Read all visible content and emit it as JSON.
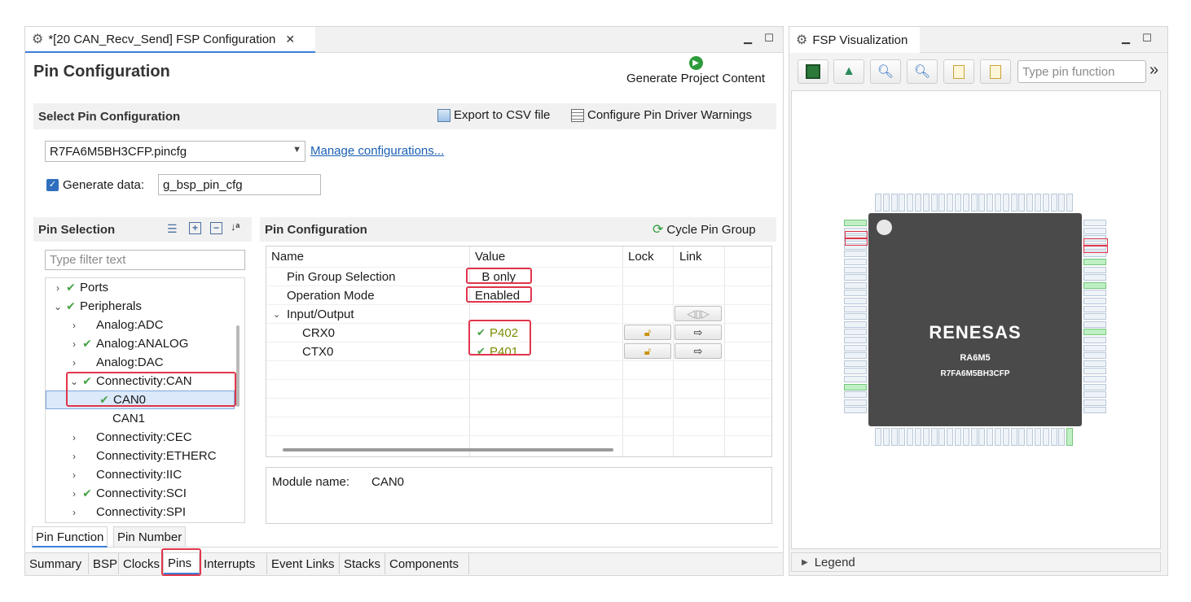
{
  "editor": {
    "tab_title": "*[20 CAN_Recv_Send] FSP Configuration",
    "page_title": "Pin Configuration",
    "generate_label": "Generate Project Content",
    "select_section_title": "Select Pin Configuration",
    "export_label": "Export to CSV file",
    "warnings_label": "Configure Pin Driver Warnings",
    "config_file": "R7FA6M5BH3CFP.pincfg",
    "manage_link": "Manage configurations...",
    "generate_data_label": "Generate data:",
    "generate_data_value": "g_bsp_pin_cfg"
  },
  "pin_selection": {
    "title": "Pin Selection",
    "filter_placeholder": "Type filter text",
    "tree": [
      {
        "label": "Ports",
        "check": true,
        "expand": ">",
        "indent": 0
      },
      {
        "label": "Peripherals",
        "check": true,
        "expand": "v",
        "indent": 0
      },
      {
        "label": "Analog:ADC",
        "check": false,
        "expand": ">",
        "indent": 1
      },
      {
        "label": "Analog:ANALOG",
        "check": true,
        "expand": ">",
        "indent": 1
      },
      {
        "label": "Analog:DAC",
        "check": false,
        "expand": ">",
        "indent": 1
      },
      {
        "label": "Connectivity:CAN",
        "check": true,
        "expand": "v",
        "indent": 1
      },
      {
        "label": "CAN0",
        "check": true,
        "expand": "",
        "indent": 2,
        "selected": true
      },
      {
        "label": "CAN1",
        "check": false,
        "expand": "",
        "indent": 2
      },
      {
        "label": "Connectivity:CEC",
        "check": false,
        "expand": ">",
        "indent": 1
      },
      {
        "label": "Connectivity:ETHERC",
        "check": false,
        "expand": ">",
        "indent": 1
      },
      {
        "label": "Connectivity:IIC",
        "check": false,
        "expand": ">",
        "indent": 1
      },
      {
        "label": "Connectivity:SCI",
        "check": true,
        "expand": ">",
        "indent": 1
      },
      {
        "label": "Connectivity:SPI",
        "check": false,
        "expand": ">",
        "indent": 1
      }
    ]
  },
  "pin_config": {
    "title": "Pin Configuration",
    "cycle_label": "Cycle Pin Group",
    "columns": [
      "Name",
      "Value",
      "Lock",
      "Link"
    ],
    "rows": [
      {
        "name": "Pin Group Selection",
        "value": "_B only"
      },
      {
        "name": "Operation Mode",
        "value": "Enabled"
      },
      {
        "name": "Input/Output",
        "value": ""
      },
      {
        "name": "CRX0",
        "value": "P402"
      },
      {
        "name": "CTX0",
        "value": "P401"
      }
    ],
    "module_label": "Module name:",
    "module_value": "CAN0"
  },
  "sub_tabs": [
    "Pin Function",
    "Pin Number"
  ],
  "bottom_tabs": [
    "Summary",
    "BSP",
    "Clocks",
    "Pins",
    "Interrupts",
    "Event Links",
    "Stacks",
    "Components"
  ],
  "visualization": {
    "tab_title": "FSP Visualization",
    "search_placeholder": "Type pin function",
    "overflow": "»",
    "chip_brand": "RENESAS",
    "chip_model": "RA6M5",
    "chip_part": "R7FA6M5BH3CFP",
    "legend_label": "Legend"
  },
  "colors": {
    "accent": "#3b7ed8",
    "highlight": "#e0364b",
    "check": "#4aa34a",
    "link": "#1a5fb4",
    "pin_value": "#7d8a00"
  }
}
